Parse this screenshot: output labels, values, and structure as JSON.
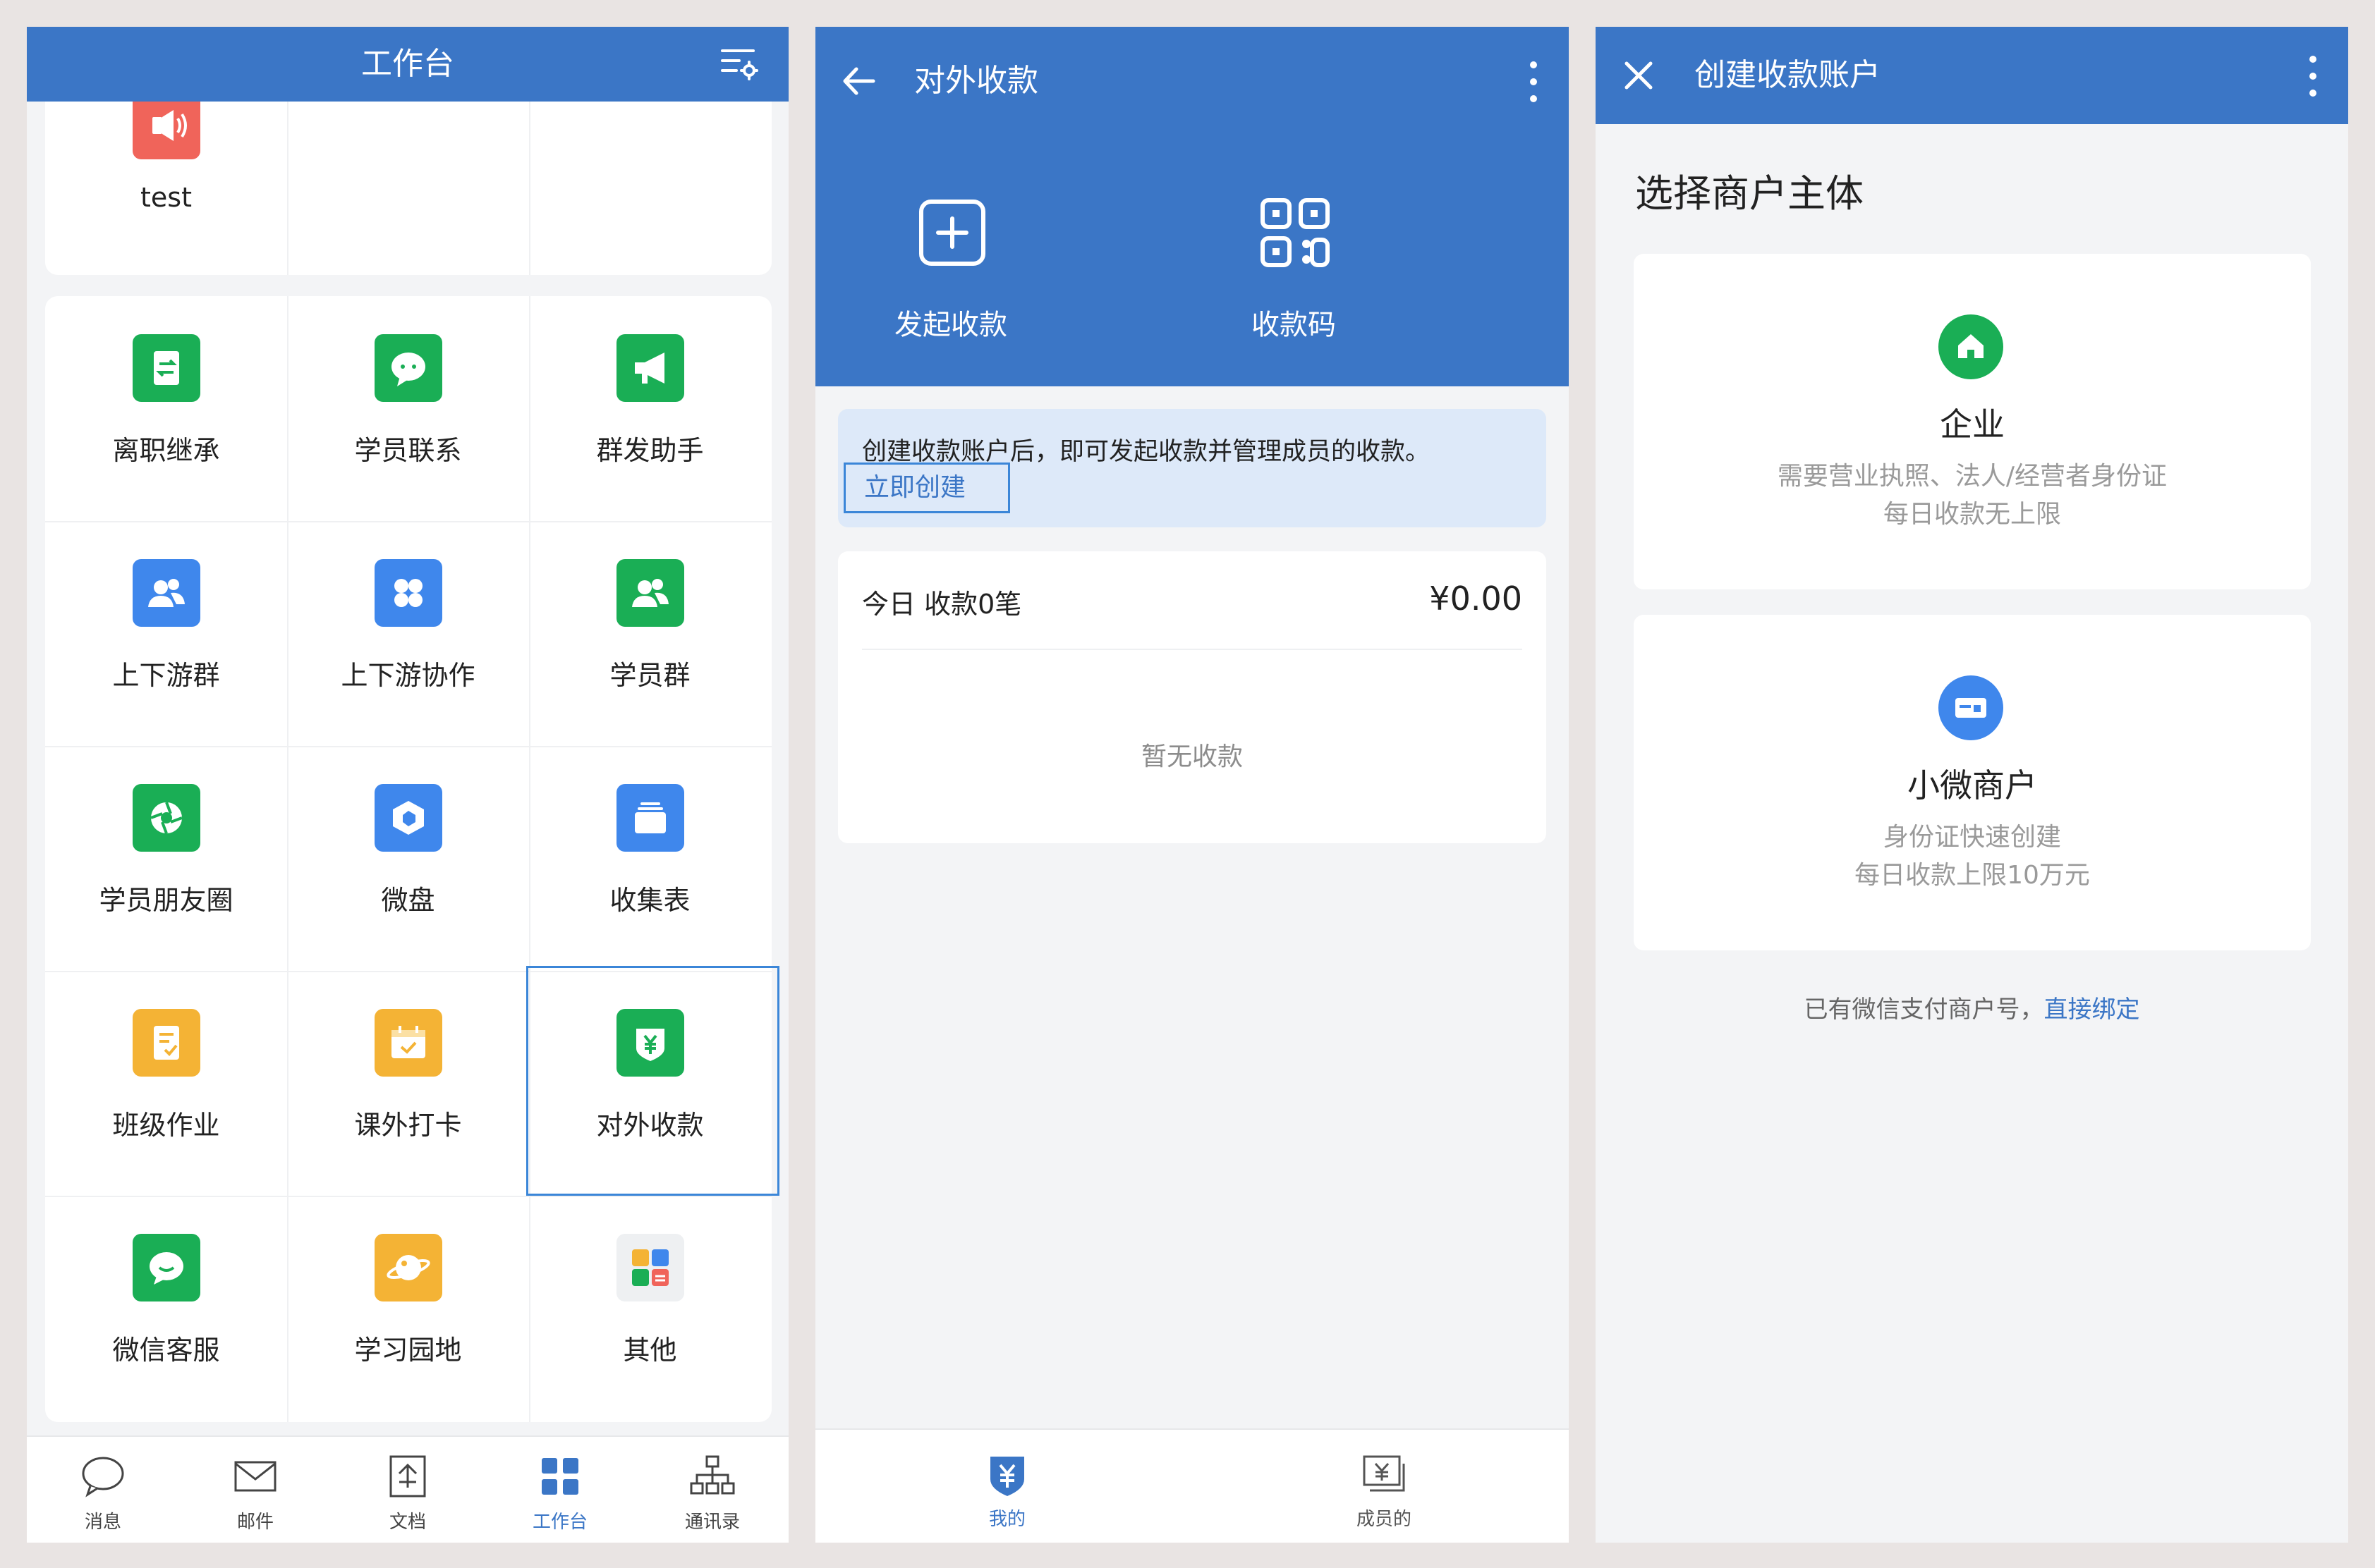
{
  "colors": {
    "header_blue": "#3b76c6",
    "selection_border": "#3b86d8",
    "green": "#1aae55",
    "blue_icon": "#3f87ec",
    "orange": "#f4b335",
    "red": "#f0645a"
  },
  "workbench": {
    "title": "工作台",
    "settings_icon": "list-settings-icon",
    "top_item": {
      "label": "test",
      "icon": "speaker-icon"
    },
    "apps": [
      {
        "label": "离职继承",
        "icon": "transfer-doc-icon",
        "color": "#1aae55"
      },
      {
        "label": "学员联系",
        "icon": "chat-bubble-icon",
        "color": "#1aae55"
      },
      {
        "label": "群发助手",
        "icon": "megaphone-icon",
        "color": "#1aae55"
      },
      {
        "label": "上下游群",
        "icon": "group-people-icon",
        "color": "#3f87ec"
      },
      {
        "label": "上下游协作",
        "icon": "four-petal-icon",
        "color": "#3f87ec"
      },
      {
        "label": "学员群",
        "icon": "student-group-icon",
        "color": "#1aae55"
      },
      {
        "label": "学员朋友圈",
        "icon": "moments-shutter-icon",
        "color": "#1aae55"
      },
      {
        "label": "微盘",
        "icon": "cloud-disk-icon",
        "color": "#3f87ec"
      },
      {
        "label": "收集表",
        "icon": "form-stack-icon",
        "color": "#3f87ec"
      },
      {
        "label": "班级作业",
        "icon": "homework-doc-icon",
        "color": "#f4b335"
      },
      {
        "label": "课外打卡",
        "icon": "calendar-check-icon",
        "color": "#f4b335"
      },
      {
        "label": "对外收款",
        "icon": "yuan-shield-icon",
        "color": "#1aae55",
        "selected": true
      },
      {
        "label": "微信客服",
        "icon": "service-chat-icon",
        "color": "#1aae55"
      },
      {
        "label": "学习园地",
        "icon": "planet-icon",
        "color": "#f4b335"
      },
      {
        "label": "其他",
        "icon": "app-grid-icon",
        "color": "#e8e8e8"
      }
    ],
    "tabs": [
      {
        "label": "消息",
        "icon": "message-icon"
      },
      {
        "label": "邮件",
        "icon": "mail-icon"
      },
      {
        "label": "文档",
        "icon": "document-icon"
      },
      {
        "label": "工作台",
        "icon": "workbench-grid-icon",
        "active": true
      },
      {
        "label": "通讯录",
        "icon": "org-chart-icon"
      }
    ]
  },
  "collect": {
    "title": "对外收款",
    "actions": [
      {
        "label": "发起收款",
        "icon": "plus-square-icon"
      },
      {
        "label": "收款码",
        "icon": "qr-code-icon"
      }
    ],
    "notice_text": "创建收款账户后，即可发起收款并管理成员的收款。",
    "create_now": "立即创建",
    "today_label": "今日 收款0笔",
    "today_amount": "¥0.00",
    "empty_text": "暂无收款",
    "tabs": [
      {
        "label": "我的",
        "icon": "yuan-shield-icon",
        "active": true
      },
      {
        "label": "成员的",
        "icon": "yuan-stack-icon"
      }
    ]
  },
  "create": {
    "title": "创建收款账户",
    "section_title": "选择商户主体",
    "options": [
      {
        "name": "企业",
        "desc1": "需要营业执照、法人/经营者身份证",
        "desc2": "每日收款无上限",
        "icon": "house-icon",
        "color": "#1aae55"
      },
      {
        "name": "小微商户",
        "desc1": "身份证快速创建",
        "desc2": "每日收款上限10万元",
        "icon": "id-card-icon",
        "color": "#3f87ec"
      }
    ],
    "bind_prefix": "已有微信支付商户号，",
    "bind_link": "直接绑定"
  }
}
